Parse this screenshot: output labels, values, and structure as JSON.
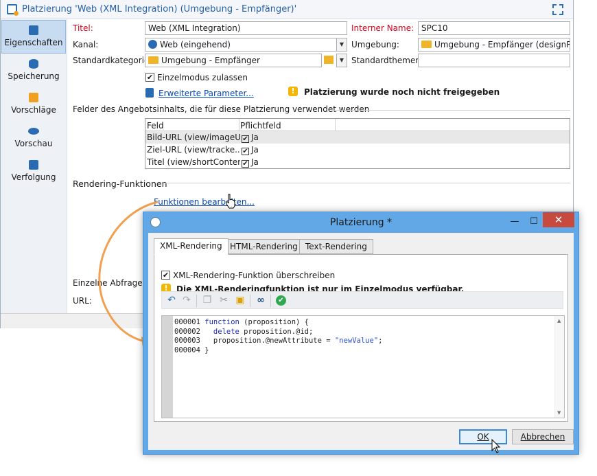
{
  "main": {
    "title": "Platzierung 'Web (XML Integration) (Umgebung - Empfänger)'",
    "sidebar": [
      {
        "label": "Eigenschaften",
        "icon": "clipboard-icon",
        "active": true
      },
      {
        "label": "Speicherung",
        "icon": "database-icon"
      },
      {
        "label": "Vorschläge",
        "icon": "gift-icon"
      },
      {
        "label": "Vorschau",
        "icon": "eye-icon"
      },
      {
        "label": "Verfolgung",
        "icon": "tracking-icon"
      }
    ],
    "form": {
      "title_label": "Titel:",
      "title_value": "Web (XML Integration)",
      "internal_name_label": "Interner Name:",
      "internal_name_value": "SPC10",
      "channel_label": "Kanal:",
      "channel_value": "Web (eingehend)",
      "environment_label": "Umgebung:",
      "environment_value": "Umgebung - Empfänger (designRcp)",
      "standard_category_label": "Standardkategorie:",
      "standard_category_value": "Umgebung - Empfänger",
      "standard_themes_label": "Standardthemen:",
      "single_mode_label": "Einzelmodus zulassen",
      "advanced_params_link": "Erweiterte Parameter...",
      "warning_not_released": "Platzierung wurde noch nicht freigegeben",
      "offer_fields_heading": "Felder des Angebotsinhalts, die für diese Platzierung verwendet werden",
      "grid_headers": [
        "Feld",
        "Pflichtfeld"
      ],
      "grid_rows": [
        {
          "field": "Bild-URL (view/imageUrl)",
          "mandatory": "Ja"
        },
        {
          "field": "Ziel-URL (view/tracke...",
          "mandatory": "Ja"
        },
        {
          "field": "Titel (view/shortContent)",
          "mandatory": "Ja"
        }
      ],
      "rendering_heading": "Rendering-Funktionen",
      "edit_functions_link": "Funktionen bearbeiten...",
      "single_queries_label": "Einzelne Abfragen",
      "url_label": "URL:"
    }
  },
  "dialog": {
    "title": "Platzierung *",
    "window_buttons": {
      "minimize": "—",
      "maximize": "☐",
      "close": "✕"
    },
    "tabs": [
      "XML-Rendering",
      "HTML-Rendering",
      "Text-Rendering"
    ],
    "override_label": "XML-Rendering-Funktion überschreiben",
    "warning_text": "Die XML-Renderingfunktion ist nur im Einzelmodus verfügbar.",
    "toolbar_icons": [
      "undo-icon",
      "redo-icon",
      "copy-icon",
      "cut-icon",
      "paste-icon",
      "find-icon",
      "check-icon"
    ],
    "code_lines": [
      {
        "num": "000001",
        "pre": "",
        "kw": "function",
        "rest": " (proposition) {"
      },
      {
        "num": "000002",
        "pre": "  ",
        "kw": "delete",
        "rest": " proposition.@id;"
      },
      {
        "num": "000003",
        "pre": "  proposition.@newAttribute = ",
        "kw": "",
        "str": "\"newValue\"",
        "rest": ";"
      },
      {
        "num": "000004",
        "pre": "}",
        "kw": "",
        "rest": ""
      }
    ],
    "ok_label": "OK",
    "cancel_label": "Abbrechen"
  }
}
